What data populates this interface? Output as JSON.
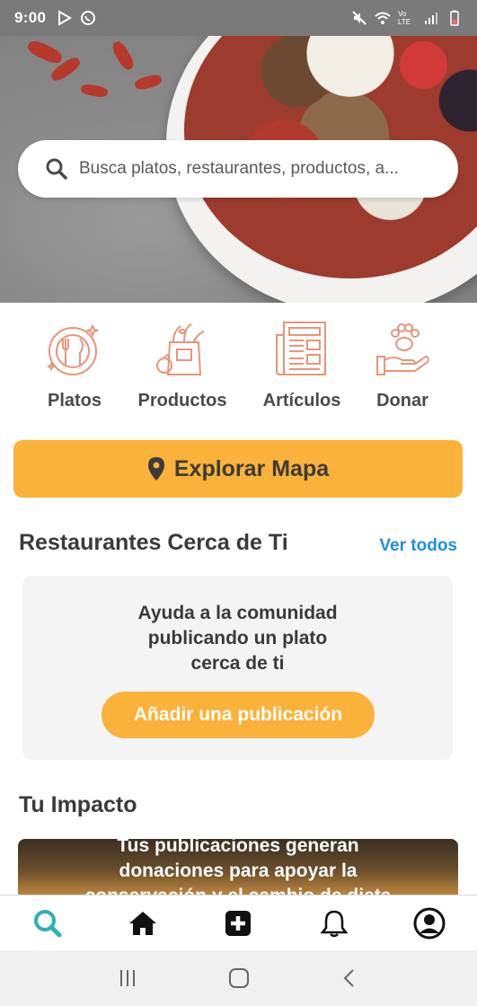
{
  "status_bar": {
    "time": "9:00",
    "left_icons": [
      "play-store-icon",
      "whatsapp-icon"
    ],
    "right_icons": [
      "mute-icon",
      "wifi-icon",
      "volte-icon",
      "signal-icon",
      "battery-icon"
    ],
    "volte_label": "Vo LTE"
  },
  "search": {
    "placeholder": "Busca platos, restaurantes, productos, a..."
  },
  "categories": [
    {
      "label": "Platos",
      "icon": "plate-icon"
    },
    {
      "label": "Productos",
      "icon": "grocery-bag-icon"
    },
    {
      "label": "Artículos",
      "icon": "newspaper-icon"
    },
    {
      "label": "Donar",
      "icon": "paw-hand-icon"
    }
  ],
  "map_button": {
    "label": "Explorar Mapa",
    "icon": "location-pin-icon"
  },
  "restaurants": {
    "title": "Restaurantes Cerca de Ti",
    "see_all": "Ver todos",
    "empty_lines": [
      "Ayuda a la comunidad",
      "publicando un plato",
      "cerca de ti"
    ],
    "add_button": "Añadir una publicación"
  },
  "impact": {
    "title": "Tu Impacto",
    "banner_lines": [
      "Tus publicaciones generan",
      "donaciones para apoyar la",
      "conservación y el cambio de dieta"
    ]
  },
  "bottom_nav": [
    "search-icon",
    "home-icon",
    "add-icon",
    "bell-icon",
    "profile-icon"
  ],
  "colors": {
    "accent": "#fbb23a",
    "link": "#1f8fe0",
    "icon_salmon": "#e8957a",
    "active_nav": "#2ab1b9"
  }
}
